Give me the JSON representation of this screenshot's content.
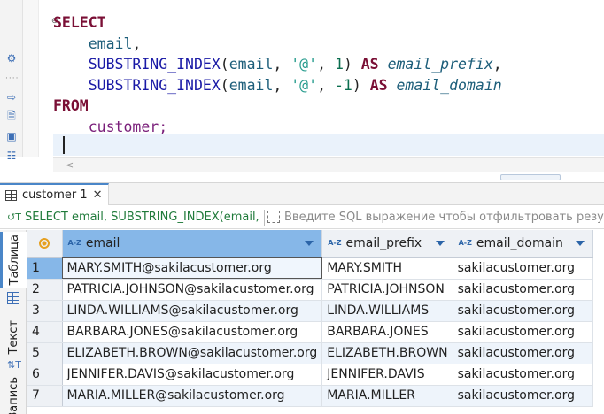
{
  "editor": {
    "lines": [
      {
        "kw": "SELECT"
      },
      {
        "id": "email",
        "punct": ","
      },
      {
        "fn": "SUBSTRING_INDEX",
        "arg1": "email",
        "str": "'@'",
        "num": "1",
        "as": "AS",
        "alias": "email_prefix",
        "punct": ","
      },
      {
        "fn": "SUBSTRING_INDEX",
        "arg1": "email",
        "str": "'@'",
        "num": "-1",
        "as": "AS",
        "alias": "email_domain"
      },
      {
        "kw": "FROM"
      },
      {
        "tbl": "customer",
        "punct": ";"
      }
    ]
  },
  "result_tab": {
    "label": "customer 1"
  },
  "filter": {
    "query_text": "SELECT email, SUBSTRING_INDEX(email,",
    "placeholder": "Введите SQL выражение чтобы отфильтровать резу"
  },
  "side_tabs": {
    "table": "Таблица",
    "text": "Текст",
    "record": "Запись"
  },
  "grid": {
    "columns": [
      "email",
      "email_prefix",
      "email_domain"
    ],
    "rows": [
      {
        "n": "1",
        "email": "MARY.SMITH@sakilacustomer.org",
        "prefix": "MARY.SMITH",
        "domain": "sakilacustomer.org"
      },
      {
        "n": "2",
        "email": "PATRICIA.JOHNSON@sakilacustomer.org",
        "prefix": "PATRICIA.JOHNSON",
        "domain": "sakilacustomer.org"
      },
      {
        "n": "3",
        "email": "LINDA.WILLIAMS@sakilacustomer.org",
        "prefix": "LINDA.WILLIAMS",
        "domain": "sakilacustomer.org"
      },
      {
        "n": "4",
        "email": "BARBARA.JONES@sakilacustomer.org",
        "prefix": "BARBARA.JONES",
        "domain": "sakilacustomer.org"
      },
      {
        "n": "5",
        "email": "ELIZABETH.BROWN@sakilacustomer.org",
        "prefix": "ELIZABETH.BROWN",
        "domain": "sakilacustomer.org"
      },
      {
        "n": "6",
        "email": "JENNIFER.DAVIS@sakilacustomer.org",
        "prefix": "JENNIFER.DAVIS",
        "domain": "sakilacustomer.org"
      },
      {
        "n": "7",
        "email": "MARIA.MILLER@sakilacustomer.org",
        "prefix": "MARIA.MILLER",
        "domain": "sakilacustomer.org"
      }
    ]
  },
  "colors": {
    "selection": "#86b7e8",
    "accent": "#4a86c8",
    "keyword": "#7a0f35",
    "function": "#1a1aa6"
  }
}
